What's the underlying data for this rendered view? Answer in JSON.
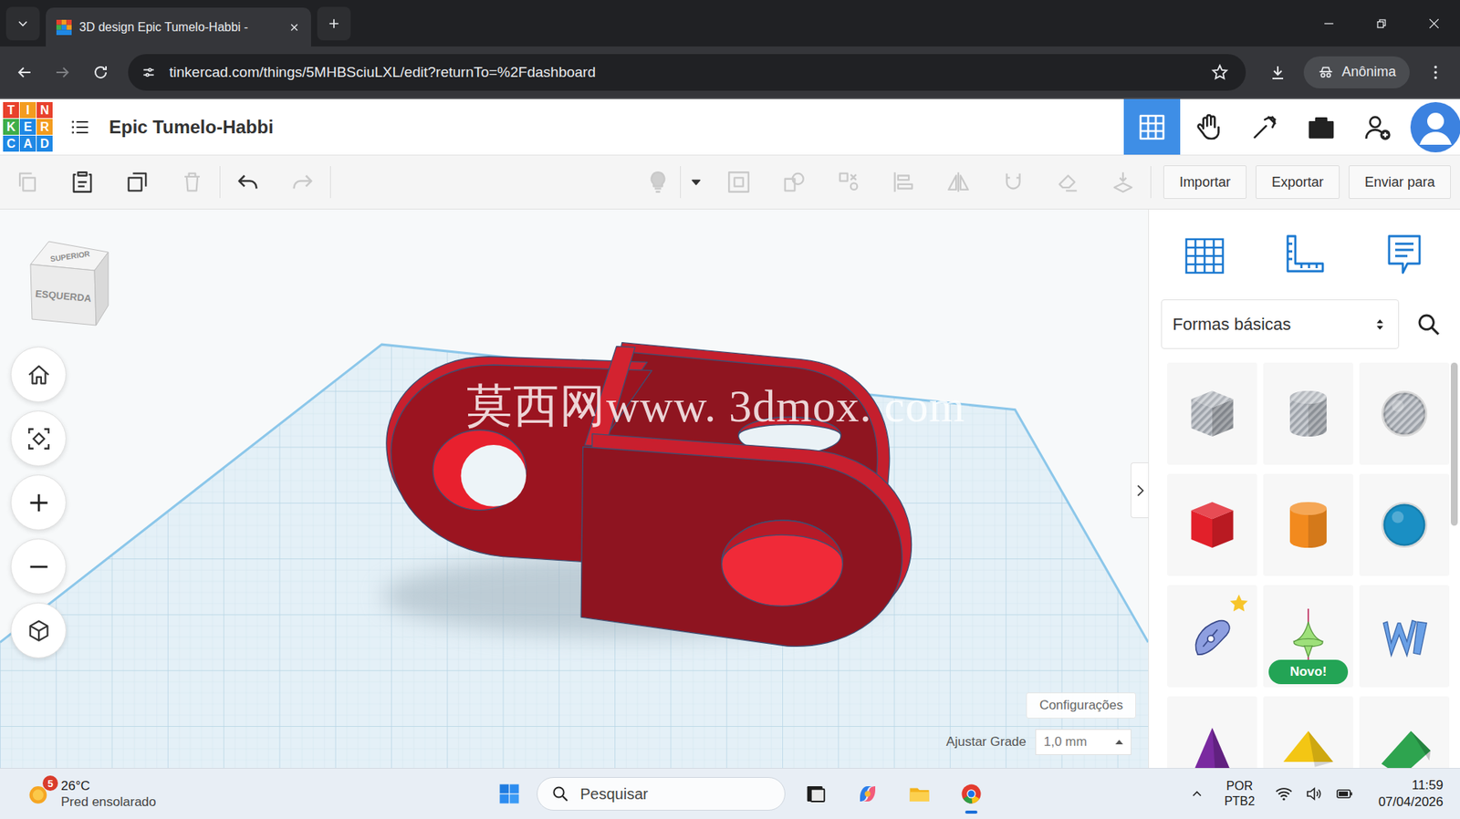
{
  "browser": {
    "tab_title": "3D design Epic Tumelo-Habbi -",
    "url": "tinkercad.com/things/5MHBSciuLXL/edit?returnTo=%2Fdashboard",
    "profile": "Anônima",
    "forward_disabled": true
  },
  "app": {
    "logo": [
      {
        "letter": "T",
        "color": "#e8412c"
      },
      {
        "letter": "I",
        "color": "#f39c1f"
      },
      {
        "letter": "N",
        "color": "#e8412c"
      },
      {
        "letter": "K",
        "color": "#3fae49"
      },
      {
        "letter": "E",
        "color": "#1e88e5"
      },
      {
        "letter": "R",
        "color": "#f39c1f"
      },
      {
        "letter": "C",
        "color": "#1e88e5"
      },
      {
        "letter": "A",
        "color": "#1e88e5"
      },
      {
        "letter": "D",
        "color": "#1e88e5"
      }
    ],
    "title": "Epic Tumelo-Habbi",
    "views": [
      {
        "selected": true
      },
      {
        "selected": false
      },
      {
        "selected": false
      },
      {
        "selected": false
      }
    ]
  },
  "toolbar": {
    "edit_tools": [
      {
        "disabled": true
      },
      {
        "disabled": false
      },
      {
        "disabled": false
      },
      {
        "disabled": true
      }
    ],
    "history": [
      {
        "disabled": false
      },
      {
        "disabled": true
      }
    ],
    "shape_tools": [
      {
        "disabled": true
      },
      {
        "disabled": false
      },
      {
        "disabled": true
      },
      {
        "disabled": true
      },
      {
        "disabled": true
      },
      {
        "disabled": true
      },
      {
        "disabled": true
      },
      {
        "disabled": true
      },
      {
        "disabled": true
      },
      {
        "disabled": true
      }
    ],
    "actions": [
      "Importar",
      "Exportar",
      "Enviar para"
    ]
  },
  "canvas": {
    "view_cube": {
      "top": "SUPERIOR",
      "front": "ESQUERDA"
    },
    "watermark": "莫西网www. 3dmox. com",
    "settings": "Configurações",
    "snap_grid": {
      "label": "Ajustar Grade",
      "value": "1,0 mm"
    }
  },
  "panel": {
    "library": "Formas básicas",
    "shapes": [
      {
        "kind": "box",
        "color": "#a9adb3",
        "hole": true,
        "favorite": false
      },
      {
        "kind": "cylinder",
        "color": "#a9adb3",
        "hole": true,
        "favorite": false
      },
      {
        "kind": "sphere",
        "color": "#a9adb3",
        "hole": true,
        "favorite": false
      },
      {
        "kind": "box",
        "color": "#e2202a",
        "hole": false,
        "favorite": false
      },
      {
        "kind": "cylinder",
        "color": "#f28a1e",
        "hole": false,
        "favorite": false
      },
      {
        "kind": "sphere",
        "color": "#1a8fc4",
        "hole": false,
        "favorite": false
      },
      {
        "kind": "scribble",
        "color": "#8e9fe0",
        "hole": false,
        "favorite": true
      },
      {
        "kind": "spinner",
        "color": "#9ee07a",
        "hole": false,
        "favorite": false,
        "badge": "Novo!"
      },
      {
        "kind": "text3d",
        "color": "#6aa0e6",
        "hole": false,
        "favorite": false
      },
      {
        "kind": "pyramid",
        "color": "#7a2aa0",
        "hole": false,
        "favorite": false
      },
      {
        "kind": "roof",
        "color": "#f3c614",
        "hole": false,
        "favorite": false
      },
      {
        "kind": "wedge",
        "color": "#2ea44f",
        "hole": false,
        "favorite": false
      }
    ]
  },
  "taskbar": {
    "weather": {
      "temp": "26°C",
      "desc": "Pred ensolarado",
      "badge": "5"
    },
    "search": "Pesquisar",
    "apps": [
      {
        "active": false
      },
      {
        "active": false
      },
      {
        "active": false
      },
      {
        "active": true
      }
    ],
    "lang": [
      "POR",
      "PTB2"
    ],
    "time": "11:59",
    "date": "07/04/2026"
  }
}
